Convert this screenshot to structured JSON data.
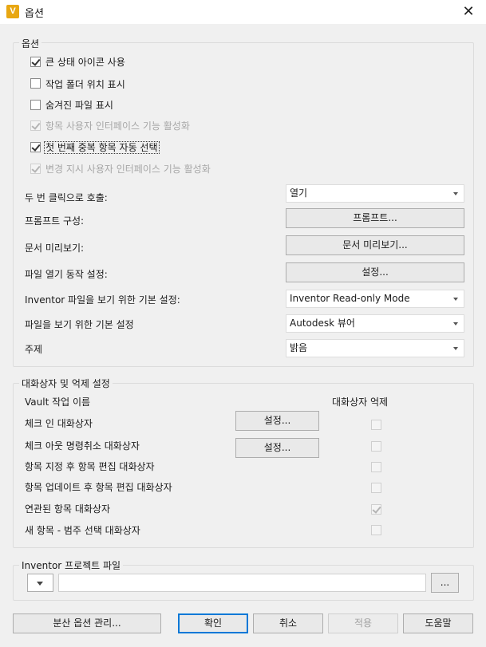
{
  "window": {
    "title": "옵션",
    "icon_letter": "V",
    "close_glyph": "✕"
  },
  "options": {
    "legend": "옵션",
    "checkboxes": [
      {
        "label": "큰 상태 아이콘 사용",
        "checked": true,
        "disabled": false
      },
      {
        "label": "작업 폴더 위치 표시",
        "checked": false,
        "disabled": false
      },
      {
        "label": "숨겨진 파일 표시",
        "checked": false,
        "disabled": false
      },
      {
        "label": "항목 사용자 인터페이스 기능 활성화",
        "checked": true,
        "disabled": true
      },
      {
        "label": "첫 번째 중복 항목 자동 선택",
        "checked": true,
        "disabled": false
      },
      {
        "label": "변경 지시 사용자 인터페이스 기능 활성화",
        "checked": true,
        "disabled": true
      }
    ],
    "double_click": {
      "label": "두 번 클릭으로 호출:",
      "value": "열기"
    },
    "prompt_config": {
      "label": "프롬프트 구성:",
      "button": "프롬프트..."
    },
    "doc_preview": {
      "label": "문서 미리보기:",
      "button": "문서 미리보기..."
    },
    "file_open": {
      "label": "파일 열기 동작 설정:",
      "button": "설정..."
    },
    "inventor_view": {
      "label": "Inventor 파일을 보기 위한 기본 설정:",
      "value": "Inventor Read-only Mode"
    },
    "file_view": {
      "label": "파일을 보기 위한 기본 설정",
      "value": "Autodesk 뷰어"
    },
    "theme": {
      "label": "주제",
      "value": "밝음"
    }
  },
  "dialogs": {
    "legend": "대화상자 및 억제 설정",
    "col_name": "Vault 작업 이름",
    "col_suppress": "대화상자 억제",
    "rows": [
      {
        "label": "체크 인 대화상자",
        "button": "설정...",
        "suppressed": false
      },
      {
        "label": "체크 아웃 명령취소 대화상자",
        "button": "설정...",
        "suppressed": false
      },
      {
        "label": "항목 지정 후 항목 편집 대화상자",
        "button": "",
        "suppressed": false
      },
      {
        "label": "항목 업데이트 후 항목 편집 대화상자",
        "button": "",
        "suppressed": false
      },
      {
        "label": "연관된 항목 대화상자",
        "button": "",
        "suppressed": true
      },
      {
        "label": "새 항목 - 범주 선택 대화상자",
        "button": "",
        "suppressed": false
      }
    ]
  },
  "project": {
    "legend": "Inventor 프로젝트 파일",
    "path_value": "",
    "browse_button": "..."
  },
  "footer": {
    "manage": "분산 옵션 관리...",
    "ok": "확인",
    "cancel": "취소",
    "apply": "적용",
    "help": "도움말"
  }
}
